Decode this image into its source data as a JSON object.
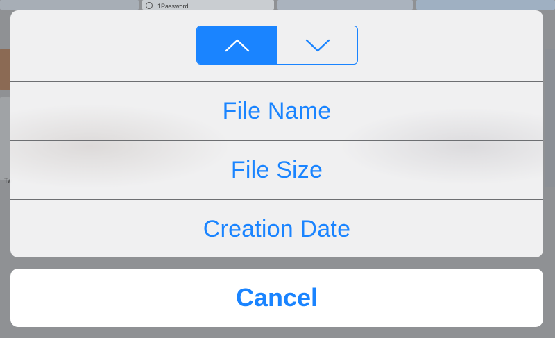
{
  "background": {
    "app_name": "1Password",
    "tile_caption": "Tw"
  },
  "sort_sheet": {
    "direction": {
      "selected": "ascending",
      "segments": [
        {
          "icon": "chevron-up-icon"
        },
        {
          "icon": "chevron-down-icon"
        }
      ]
    },
    "options": [
      {
        "label": "File Name"
      },
      {
        "label": "File Size"
      },
      {
        "label": "Creation Date"
      }
    ],
    "cancel_label": "Cancel"
  },
  "colors": {
    "accent": "#1a84ff",
    "sheet_background": "#f4f4f5",
    "divider": "#6d6f72"
  }
}
